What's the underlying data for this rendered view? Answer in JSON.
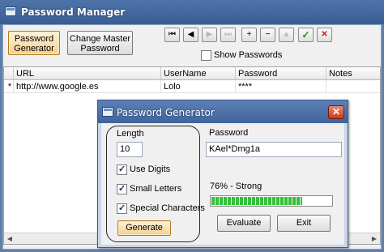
{
  "main": {
    "title": "Password Manager",
    "btn_generator": [
      "Password",
      "Generator"
    ],
    "btn_change_master": [
      "Change Master",
      "Password"
    ],
    "nav": {
      "first": "⏮",
      "prev": "◀",
      "next": "▶",
      "last": "⏭",
      "add": "+",
      "delete": "−",
      "move_up": "▲",
      "confirm": "✓",
      "cancel": "✕"
    },
    "show_passwords_label": "Show Passwords",
    "show_passwords_checked": false,
    "grid": {
      "columns": [
        "URL",
        "UserName",
        "Password",
        "Notes"
      ],
      "rows": [
        {
          "marker": "*",
          "url": "http://www.google.es",
          "username": "Lolo",
          "password": "****",
          "notes": ""
        }
      ]
    }
  },
  "dialog": {
    "title": "Password Generator",
    "length_label": "Length",
    "length_value": "10",
    "use_digits_label": "Use Digits",
    "use_digits_checked": true,
    "small_letters_label": "Small Letters",
    "small_letters_checked": true,
    "special_chars_label": "Special Characters",
    "special_chars_checked": true,
    "generate_label": "Generate",
    "password_label": "Password",
    "password_value": "KAel*Dmg1a",
    "strength_text": "76% - Strong",
    "strength_percent": 76,
    "evaluate_label": "Evaluate",
    "exit_label": "Exit"
  },
  "colors": {
    "title_bar": "#3f649b",
    "accent_orange": "#f3cf8f",
    "strength_green": "#35c13a",
    "close_red": "#c43a1f"
  }
}
